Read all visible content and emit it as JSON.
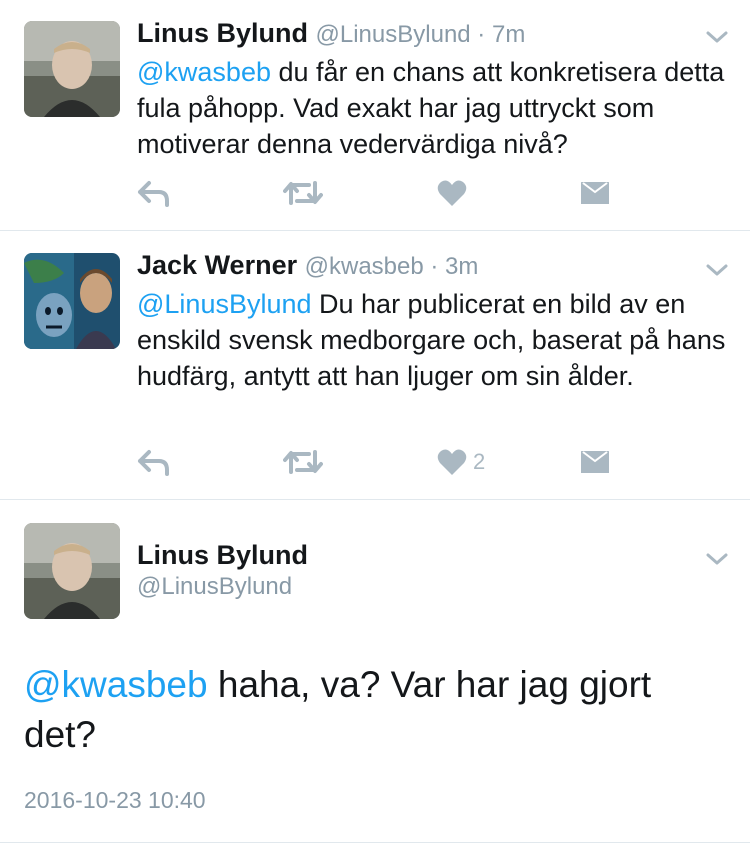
{
  "colors": {
    "accent": "#1da1f2",
    "muted": "#8899a6",
    "icon": "#aab8c2",
    "divider": "#e1e8ed"
  },
  "tweets": [
    {
      "name": "Linus Bylund",
      "handle": "@LinusBylund",
      "time": "7m",
      "mention": "@kwasbeb",
      "text": " du får en chans att konkretisera detta fula påhopp. Vad exakt har jag uttryckt som motiverar denna vedervärdiga nivå?",
      "like_count": ""
    },
    {
      "name": "Jack Werner",
      "handle": "@kwasbeb",
      "time": "3m",
      "mention": "@LinusBylund",
      "text": " Du har publicerat en bild av en enskild svensk medborgare och, baserat på hans hudfärg, antytt att han ljuger om sin ålder.",
      "like_count": "2"
    }
  ],
  "focused": {
    "name": "Linus Bylund",
    "handle": "@LinusBylund",
    "mention": "@kwasbeb",
    "text": " haha, va? Var har jag gjort det?",
    "timestamp": "2016-10-23 10:40"
  },
  "separator": " · ",
  "icons": [
    "reply-icon",
    "retweet-icon",
    "heart-icon",
    "direct-message-icon",
    "chevron-down-icon"
  ]
}
